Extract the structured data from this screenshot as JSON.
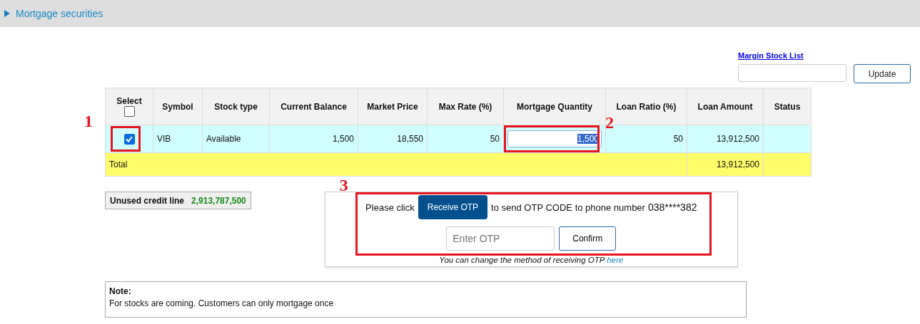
{
  "section": {
    "title": "Mortgage securities"
  },
  "margin_link": "Margin Stock List",
  "update_button": "Update",
  "table": {
    "columns": [
      "Select",
      "Symbol",
      "Stock type",
      "Current Balance",
      "Market Price",
      "Max Rate (%)",
      "Mortgage Quantity",
      "Loan Ratio (%)",
      "Loan Amount",
      "Status"
    ],
    "select_all_checked": false,
    "rows": [
      {
        "checked": true,
        "symbol": "VIB",
        "stock_type": "Available",
        "current_balance": "1,500",
        "market_price": "18,550",
        "max_rate": "50",
        "mortgage_quantity": "1,500",
        "loan_ratio": "50",
        "loan_amount": "13,912,500"
      }
    ],
    "total": {
      "label": "Total",
      "loan_amount": "13,912,500"
    }
  },
  "credit": {
    "label": "Unused credit line",
    "value": "2,913,787,500"
  },
  "otp": {
    "prefix": "Please click",
    "button": "Receive OTP",
    "suffix": "to send OTP CODE to phone number",
    "phone": "038****382",
    "placeholder": "Enter OTP",
    "confirm": "Confirm",
    "hint": "You can change the method of receiving OTP",
    "link": "here"
  },
  "note": {
    "title": "Note:",
    "text": "For stocks are coming. Customers can only mortgage once"
  },
  "annotations": [
    "1",
    "2",
    "3"
  ]
}
